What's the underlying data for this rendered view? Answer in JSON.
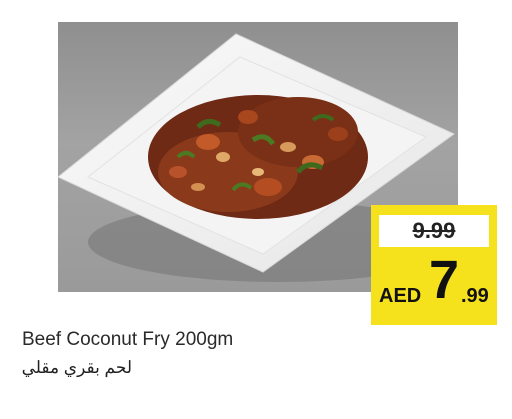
{
  "product": {
    "name": "Beef Coconut Fry 200gm",
    "name_ar": "لحم بقري مقلي",
    "image": "beef-coconut-fry-on-white-plate"
  },
  "price": {
    "old": "9.99",
    "currency": "AED",
    "integer": "7",
    "decimal": ".99"
  },
  "colors": {
    "tag": "#f6e11d",
    "background": "#ffffff",
    "photo_backdrop": "#9a9a9a"
  }
}
